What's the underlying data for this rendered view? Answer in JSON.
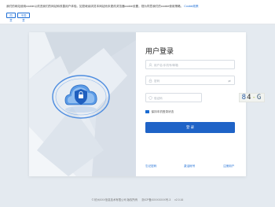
{
  "cookie": {
    "text": "我们的网站使用cookie以改进我们的网站和改善用户体验。如您继续浏览本网站而未更改浏览器cookie设置，视为同意我们的cookie使用策略。",
    "policy_link": "Cookie政策",
    "accept_label": "同 意",
    "reject_label": "不同意"
  },
  "login": {
    "title": "用户登录",
    "username_placeholder": "用户名/手机号/邮箱",
    "password_placeholder": "密码",
    "captcha_placeholder": "验证码",
    "captcha_chars": [
      "8",
      "4",
      "-",
      "G"
    ],
    "remember_label": "保持本机登录状态",
    "submit_label": "登 录",
    "links": {
      "forgot": "忘记密码",
      "activate": "激活帐号",
      "register": "注册用户"
    }
  },
  "footer": {
    "copyright": "© 杭州XXX信息技术有限公司 版权所有",
    "icp": "浙ICP备XXXXXXXX号-3",
    "version": "v2.0.16"
  },
  "colors": {
    "primary": "#1f63c7",
    "link": "#1f6fd6",
    "background": "#e4eaf0"
  }
}
